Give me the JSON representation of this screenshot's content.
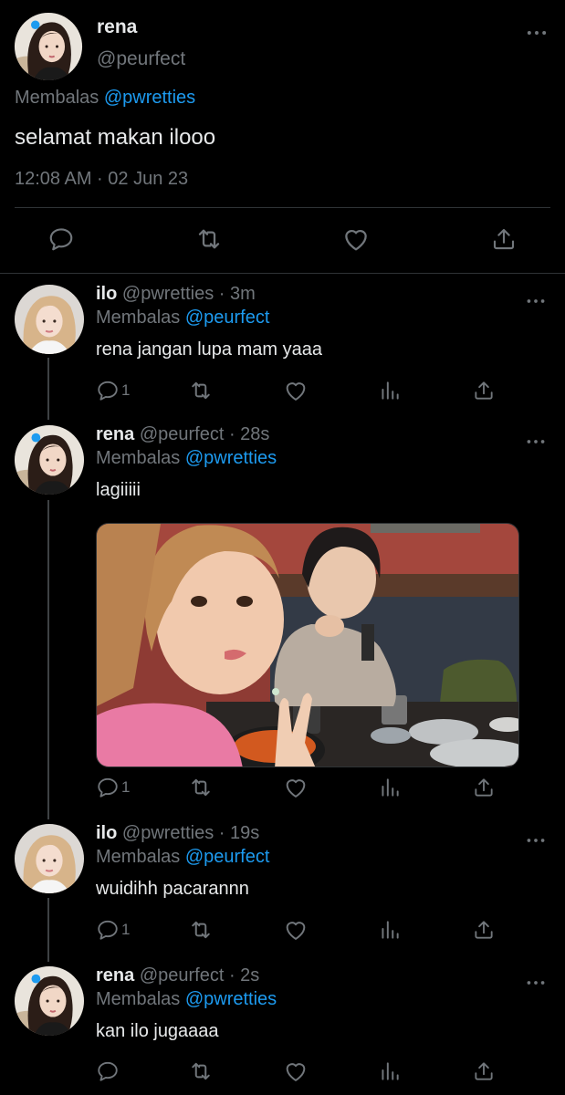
{
  "main_tweet": {
    "name": "rena",
    "handle": "@peurfect",
    "replying_prefix": "Membalas",
    "replying_to": "@pwretties",
    "text": "selamat makan ilooo",
    "timestamp": "12:08 AM · 02 Jun 23"
  },
  "replies": [
    {
      "name": "ilo",
      "handle": "@pwretties · 3m",
      "replying_prefix": "Membalas",
      "replying_to": "@peurfect",
      "text": "rena jangan lupa mam yaaa",
      "reply_count": "1"
    },
    {
      "name": "rena",
      "handle": "@peurfect · 28s",
      "replying_prefix": "Membalas",
      "replying_to": "@pwretties",
      "text": "lagiiiii",
      "reply_count": "1"
    },
    {
      "name": "ilo",
      "handle": "@pwretties · 19s",
      "replying_prefix": "Membalas",
      "replying_to": "@peurfect",
      "text": "wuidihh pacarannn",
      "reply_count": "1"
    },
    {
      "name": "rena",
      "handle": "@peurfect · 2s",
      "replying_prefix": "Membalas",
      "replying_to": "@pwretties",
      "text": "kan ilo jugaaaa",
      "reply_count": ""
    }
  ],
  "icons": {
    "reply": "reply-icon",
    "retweet": "retweet-icon",
    "like": "heart-icon",
    "views": "views-icon",
    "share": "share-icon",
    "more": "more-icon"
  },
  "colors": {
    "background": "#000000",
    "text": "#e7e9ea",
    "muted": "#71767b",
    "link": "#1d9bf0",
    "separator": "#2f3336"
  }
}
